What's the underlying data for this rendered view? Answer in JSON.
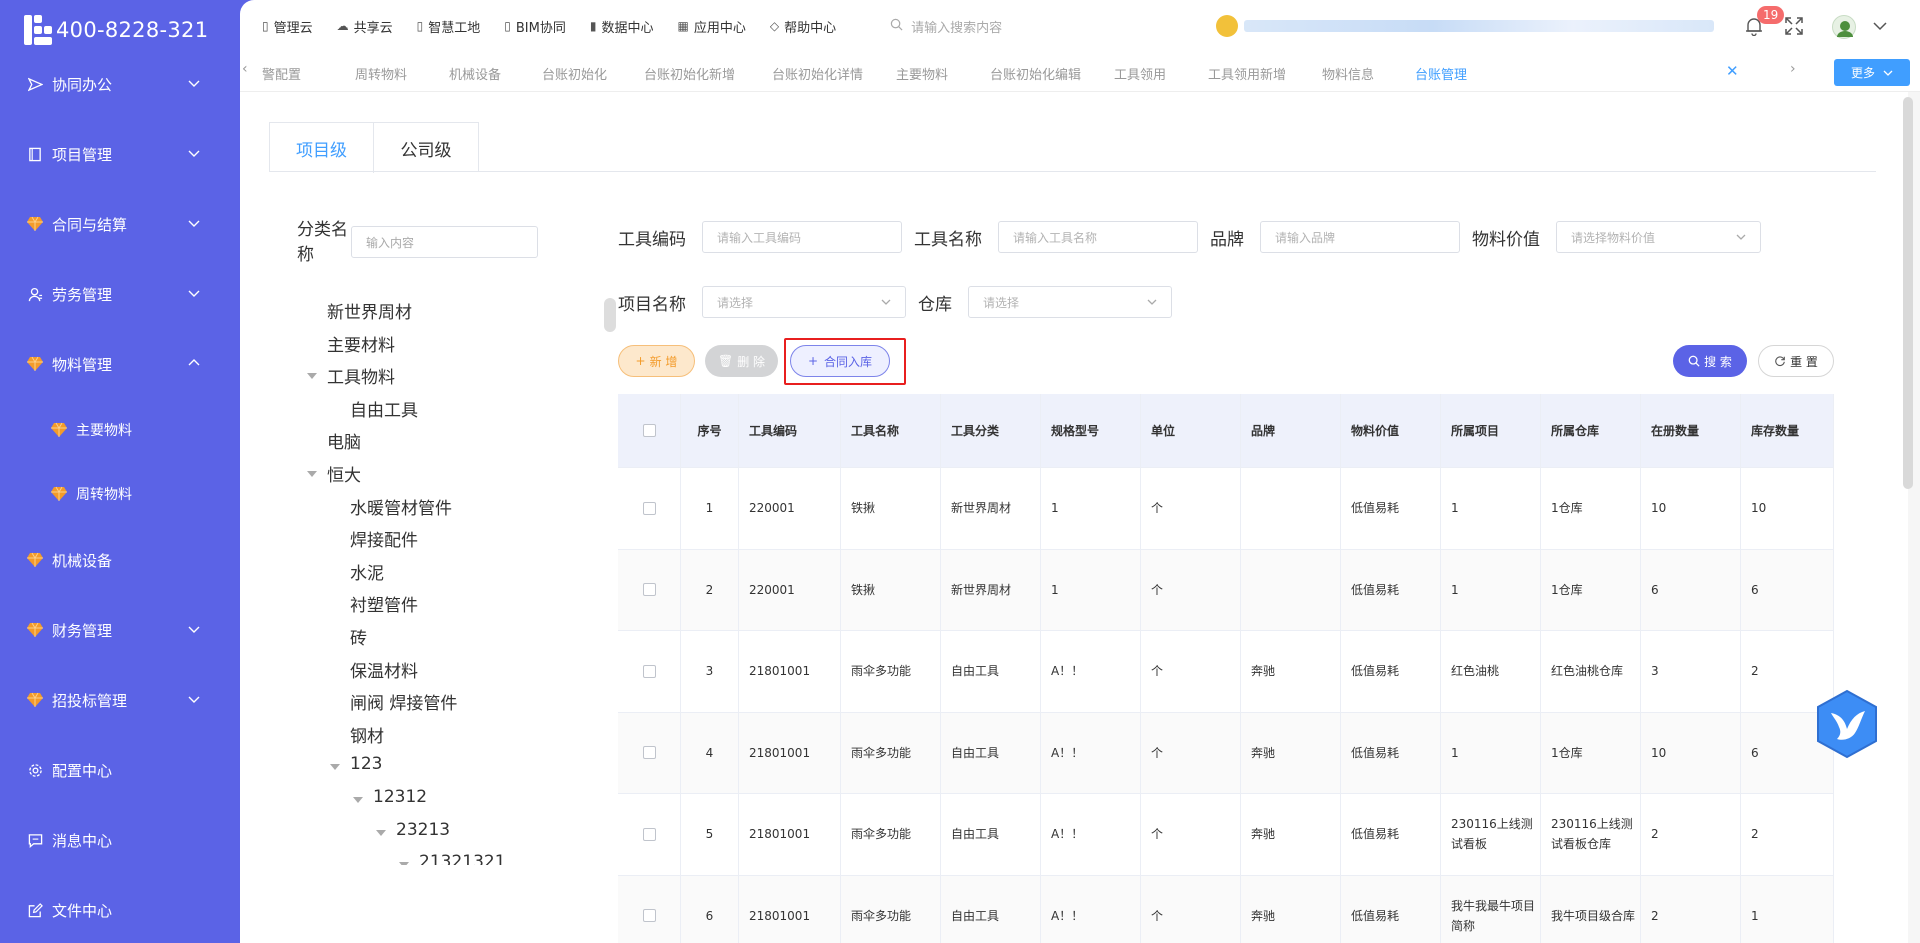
{
  "app": {
    "phone": "400-8228-321"
  },
  "sidebar": {
    "items": [
      {
        "label": "协同办公",
        "icon": "send-icon",
        "expand": "down"
      },
      {
        "label": "项目管理",
        "icon": "book-icon",
        "expand": "down"
      },
      {
        "label": "合同与结算",
        "icon": "gem-icon",
        "expand": "down"
      },
      {
        "label": "劳务管理",
        "icon": "user-icon",
        "expand": "down"
      },
      {
        "label": "物料管理",
        "icon": "gem-icon",
        "expand": "up"
      },
      {
        "label": "主要物料",
        "icon": "gem-icon",
        "sub": true
      },
      {
        "label": "周转物料",
        "icon": "gem-icon",
        "sub": true
      },
      {
        "label": "机械设备",
        "icon": "gem-icon",
        "expand": "none"
      },
      {
        "label": "财务管理",
        "icon": "gem-icon",
        "expand": "down"
      },
      {
        "label": "招投标管理",
        "icon": "gem-icon",
        "expand": "down"
      },
      {
        "label": "配置中心",
        "icon": "gear-icon",
        "expand": "none"
      },
      {
        "label": "消息中心",
        "icon": "message-icon",
        "expand": "none"
      },
      {
        "label": "文件中心",
        "icon": "edit-icon",
        "expand": "none"
      }
    ]
  },
  "topnav": {
    "items": [
      {
        "label": "管理云",
        "icon": "doc-icon"
      },
      {
        "label": "共享云",
        "icon": "cloud-icon"
      },
      {
        "label": "智慧工地",
        "icon": "doc-icon"
      },
      {
        "label": "BIM协同",
        "icon": "doc-icon"
      },
      {
        "label": "数据中心",
        "icon": "bar-chart-icon"
      },
      {
        "label": "应用中心",
        "icon": "grid-icon"
      },
      {
        "label": "帮助中心",
        "icon": "diamond-icon"
      }
    ],
    "search_placeholder": "请输入搜索内容",
    "notifications": "19"
  },
  "tabs": {
    "items": [
      "警配置",
      "周转物料",
      "机械设备",
      "台账初始化",
      "台账初始化新增",
      "台账初始化详情",
      "主要物料",
      "台账初始化编辑",
      "工具领用",
      "工具领用新增",
      "物料信息",
      "台账管理"
    ],
    "active": "台账管理",
    "more": "更多"
  },
  "level_tabs": {
    "project": "项目级",
    "company": "公司级"
  },
  "tree": {
    "label": "分类名称",
    "placeholder": "输入内容",
    "nodes": [
      {
        "label": "新世界周材",
        "level": 1
      },
      {
        "label": "主要材料",
        "level": 1
      },
      {
        "label": "工具物料",
        "level": 1,
        "caret": true
      },
      {
        "label": "自由工具",
        "level": 2
      },
      {
        "label": "电脑",
        "level": 1
      },
      {
        "label": "恒大",
        "level": 1,
        "caret": true
      },
      {
        "label": "水暖管材管件",
        "level": 2
      },
      {
        "label": "焊接配件",
        "level": 2
      },
      {
        "label": "水泥",
        "level": 2
      },
      {
        "label": "衬塑管件",
        "level": 2
      },
      {
        "label": "砖",
        "level": 2
      },
      {
        "label": "保温材料",
        "level": 2
      },
      {
        "label": "闸阀 焊接管件",
        "level": 2
      },
      {
        "label": "钢材",
        "level": 2
      },
      {
        "label": "123",
        "level": 2,
        "caret": true
      },
      {
        "label": "12312",
        "level": 3,
        "caret": true
      },
      {
        "label": "23213",
        "level": 4,
        "caret": true
      },
      {
        "label": "21321321",
        "level": 5,
        "caret": true
      }
    ]
  },
  "filters": {
    "tool_code": {
      "label": "工具编码",
      "placeholder": "请输入工具编码"
    },
    "tool_name": {
      "label": "工具名称",
      "placeholder": "请输入工具名称"
    },
    "brand": {
      "label": "品牌",
      "placeholder": "请输入品牌"
    },
    "material_value": {
      "label": "物料价值",
      "placeholder": "请选择物料价值"
    },
    "project_name": {
      "label": "项目名称",
      "placeholder": "请选择"
    },
    "warehouse": {
      "label": "仓库",
      "placeholder": "请选择"
    }
  },
  "buttons": {
    "add": "新 增",
    "delete": "删 除",
    "contract_in": "合同入库",
    "search": "搜 索",
    "reset": "重 置"
  },
  "table": {
    "headers": [
      "序号",
      "工具编码",
      "工具名称",
      "工具分类",
      "规格型号",
      "单位",
      "品牌",
      "物料价值",
      "所属项目",
      "所属仓库",
      "在册数量",
      "库存数量"
    ],
    "rows": [
      [
        "1",
        "220001",
        "铁揪",
        "新世界周材",
        "1",
        "个",
        "",
        "低值易耗",
        "1",
        "1仓库",
        "10",
        "10"
      ],
      [
        "2",
        "220001",
        "铁揪",
        "新世界周材",
        "1",
        "个",
        "",
        "低值易耗",
        "1",
        "1仓库",
        "6",
        "6"
      ],
      [
        "3",
        "21801001",
        "雨伞多功能",
        "自由工具",
        "A！！",
        "个",
        "奔驰",
        "低值易耗",
        "红色油桃",
        "红色油桃仓库",
        "3",
        "2"
      ],
      [
        "4",
        "21801001",
        "雨伞多功能",
        "自由工具",
        "A！！",
        "个",
        "奔驰",
        "低值易耗",
        "1",
        "1仓库",
        "10",
        "6"
      ],
      [
        "5",
        "21801001",
        "雨伞多功能",
        "自由工具",
        "A！！",
        "个",
        "奔驰",
        "低值易耗",
        "230116上线测试看板",
        "230116上线测试看板仓库",
        "2",
        "2"
      ],
      [
        "6",
        "21801001",
        "雨伞多功能",
        "自由工具",
        "A！！",
        "个",
        "奔驰",
        "低值易耗",
        "我牛我最牛项目简称",
        "我牛项目级合库",
        "2",
        "1"
      ]
    ]
  },
  "colors": {
    "sidebar": "#5b63e6",
    "accent": "#409eff",
    "highlight": "#e81f1f"
  }
}
